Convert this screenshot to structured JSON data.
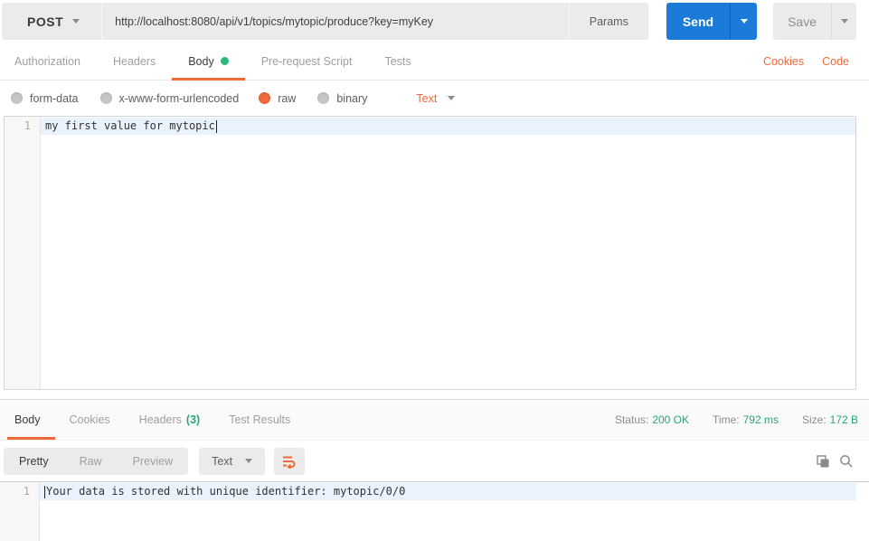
{
  "request_bar": {
    "method": "POST",
    "url": "http://localhost:8080/api/v1/topics/mytopic/produce?key=myKey",
    "params_label": "Params",
    "send_label": "Send",
    "save_label": "Save"
  },
  "request_tabs": {
    "items": [
      {
        "label": "Authorization"
      },
      {
        "label": "Headers"
      },
      {
        "label": "Body"
      },
      {
        "label": "Pre-request Script"
      },
      {
        "label": "Tests"
      }
    ],
    "active_tab": "Body",
    "cookies_label": "Cookies",
    "code_label": "Code"
  },
  "body_type": {
    "options": [
      {
        "label": "form-data",
        "selected": false
      },
      {
        "label": "x-www-form-urlencoded",
        "selected": false
      },
      {
        "label": "raw",
        "selected": true
      },
      {
        "label": "binary",
        "selected": false
      }
    ],
    "format": "Text"
  },
  "request_editor": {
    "line_number": "1",
    "content": "my first value for mytopic"
  },
  "response": {
    "tabs": [
      {
        "label": "Body"
      },
      {
        "label": "Cookies"
      },
      {
        "label": "Headers",
        "count": "(3)"
      },
      {
        "label": "Test Results"
      }
    ],
    "active_tab": "Body",
    "meta": {
      "status_label": "Status:",
      "status_value": "200 OK",
      "time_label": "Time:",
      "time_value": "792 ms",
      "size_label": "Size:",
      "size_value": "172 B"
    },
    "toolbar": {
      "views": [
        "Pretty",
        "Raw",
        "Preview"
      ],
      "active_view": "Pretty",
      "format": "Text"
    },
    "editor": {
      "line_number": "1",
      "content": "Your data is stored with unique identifier: mytopic/0/0"
    }
  },
  "icons": {
    "method_caret": "chevron-down",
    "send_caret": "chevron-down",
    "save_caret": "chevron-down",
    "format_caret": "chevron-down",
    "wrap": "text-wrap",
    "copy": "copy",
    "search": "magnifier"
  },
  "colors": {
    "accent_orange": "#f0693a",
    "send_blue": "#1a7bd9",
    "success_green": "#29a874",
    "active_line_blue": "#e9f2fd"
  }
}
